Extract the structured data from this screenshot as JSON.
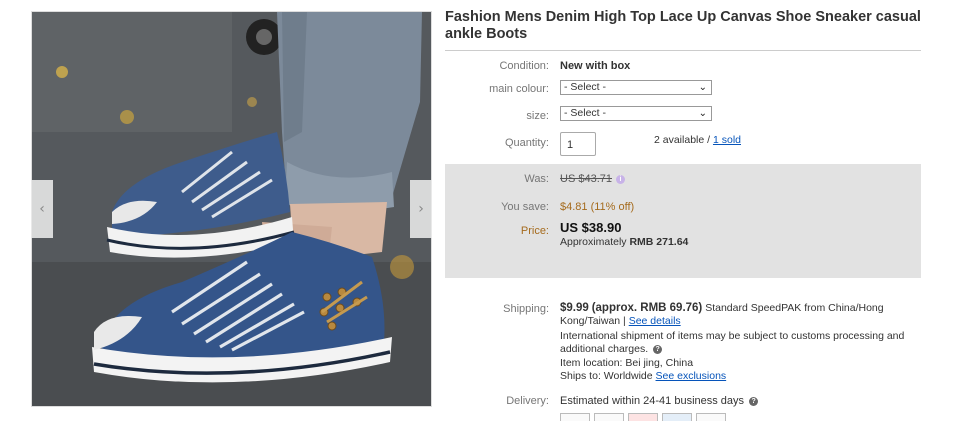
{
  "product": {
    "title": "Fashion Mens Denim High Top Lace Up Canvas Shoe Sneaker casual ankle Boots"
  },
  "gallery": {
    "image_icon": "denim-sneaker-photo",
    "prev_icon": "chevron-left-icon",
    "next_icon": "chevron-right-icon",
    "prev_glyph": "‹",
    "next_glyph": "›"
  },
  "details": {
    "condition_label": "Condition:",
    "condition_value": "New with box",
    "main_colour_label": "main colour:",
    "main_colour_selected": "- Select -",
    "size_label": "size:",
    "size_selected": "- Select -",
    "select_chevron": "⌄",
    "quantity_label": "Quantity:",
    "quantity_value": "1",
    "available_text": "2 available /",
    "sold_link": "1 sold"
  },
  "pricing": {
    "was_label": "Was:",
    "was_value": "US $43.71",
    "info_glyph": "i",
    "you_save_label": "You save:",
    "you_save_value": "$4.81 (11% off)",
    "price_label": "Price:",
    "price_value": "US $38.90",
    "approx_prefix": "Approximately",
    "approx_value": "RMB 271.64",
    "panel_color": "#e2e2e2",
    "accent_color": "#a56b1d"
  },
  "shipping": {
    "label": "Shipping:",
    "cost": "$9.99",
    "approx": "(approx. RMB 69.76)",
    "service": "Standard SpeedPAK from China/Hong Kong/Taiwan |",
    "see_details": "See details",
    "intl_note": "International shipment of items may be subject to customs processing and additional charges.",
    "item_location": "Item location:  Bei jing, China",
    "ships_to": "Ships to:  Worldwide",
    "see_exclusions": "See exclusions",
    "help_glyph": "?"
  },
  "delivery": {
    "label": "Delivery:",
    "value": "Estimated within 24-41 business days"
  },
  "payments": {
    "icons": [
      "card-icon",
      "card-icon",
      "mastercard-icon",
      "card-icon",
      "card-icon"
    ]
  },
  "colors": {
    "link": "#0654ba",
    "title": "#333333"
  }
}
